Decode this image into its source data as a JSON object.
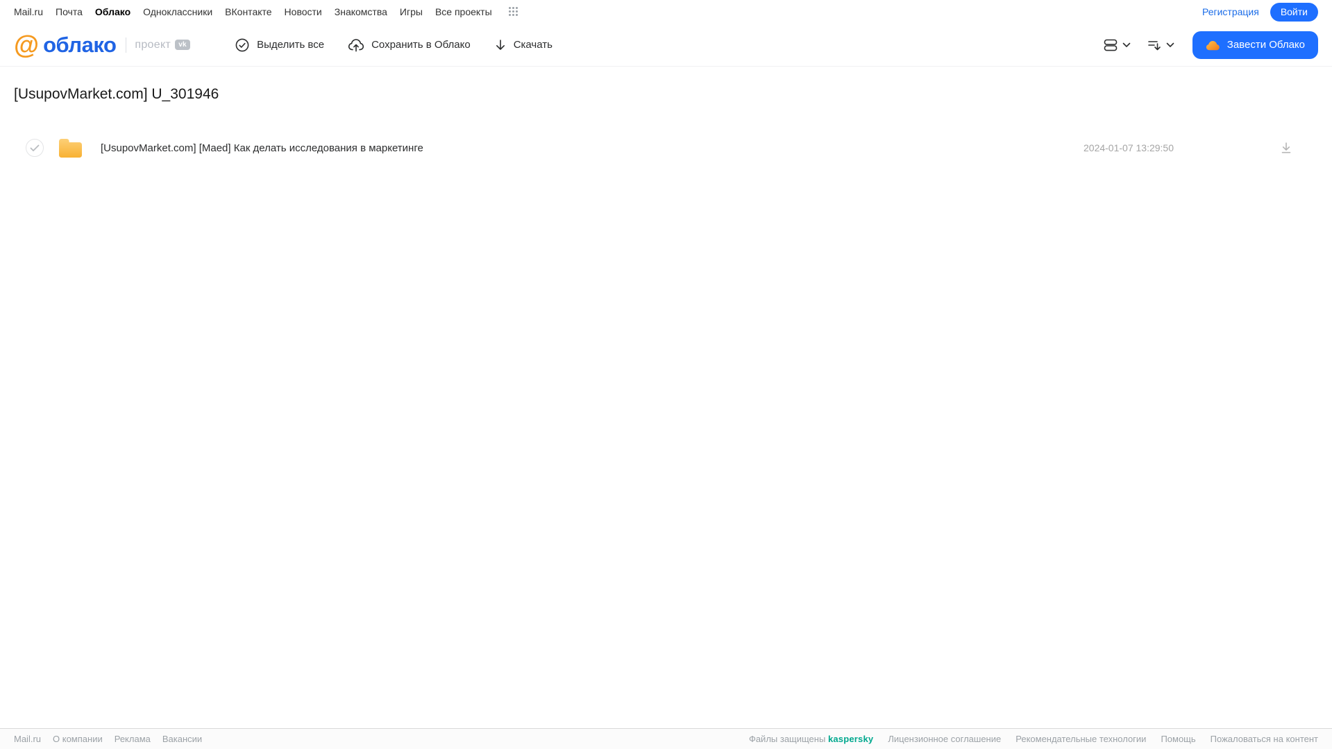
{
  "topnav": {
    "links": [
      "Mail.ru",
      "Почта",
      "Облако",
      "Одноклассники",
      "ВКонтакте",
      "Новости",
      "Знакомства",
      "Игры",
      "Все проекты"
    ],
    "active_link": "Облако",
    "registration_label": "Регистрация",
    "login_label": "Войти"
  },
  "header": {
    "logo": {
      "at": "@",
      "word": "облако",
      "project": "проект",
      "vk": "vk"
    },
    "toolbar": [
      {
        "label": "Выделить все"
      },
      {
        "label": "Сохранить в Облако"
      },
      {
        "label": "Скачать"
      }
    ],
    "create_button_label": "Завести Облако"
  },
  "main": {
    "title": "[UsupovMarket.com] U_301946",
    "files": [
      {
        "type": "folder",
        "name": "[UsupovMarket.com] [Maed] Как делать исследования в маркетинге",
        "date": "2024-01-07 13:29:50"
      }
    ]
  },
  "footer": {
    "left_links": [
      "Mail.ru",
      "О компании",
      "Реклама",
      "Вакансии"
    ],
    "protected_label": "Файлы защищены",
    "kaspersky_label": "kaspersky",
    "right_links": [
      "Лицензионное соглашение",
      "Рекомендательные технологии",
      "Помощь",
      "Пожаловаться на контент"
    ]
  },
  "colors": {
    "accent_blue": "#1e6fff",
    "logo_blue": "#2064e4",
    "logo_orange": "#f59a20",
    "folder_top": "#fdd077",
    "folder_bottom": "#f8b133",
    "kaspersky_green": "#00a88e",
    "footer_gray": "#9ba1a6"
  }
}
